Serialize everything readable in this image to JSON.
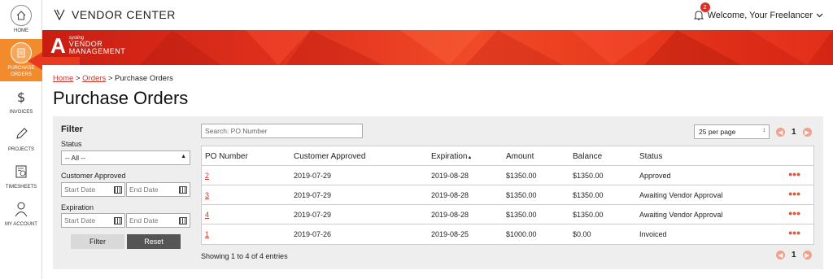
{
  "sidebar": {
    "items": [
      {
        "label": "HOME",
        "icon": "home-icon",
        "active": false
      },
      {
        "label": "PURCHASE ORDERS",
        "icon": "document-icon",
        "active": true
      },
      {
        "label": "INVOICES",
        "icon": "dollar-icon",
        "active": false
      },
      {
        "label": "PROJECTS",
        "icon": "pencil-icon",
        "active": false
      },
      {
        "label": "TIMESHEETS",
        "icon": "timesheet-icon",
        "active": false
      },
      {
        "label": "MY ACCOUNT",
        "icon": "user-icon",
        "active": false
      }
    ]
  },
  "header": {
    "brand": "VENDOR CENTER",
    "notification_count": "2",
    "welcome": "Welcome, Your Freelancer"
  },
  "banner": {
    "logo_letter": "A",
    "logo_small": "sysling",
    "logo_line1": "VENDOR",
    "logo_line2": "MANAGEMENT"
  },
  "breadcrumb": {
    "home": "Home",
    "sep1": " > ",
    "orders": "Orders",
    "sep2": " > ",
    "current": "Purchase Orders"
  },
  "page_title": "Purchase Orders",
  "filter": {
    "title": "Filter",
    "status_label": "Status",
    "status_value": "-- All --",
    "customer_approved_label": "Customer Approved",
    "expiration_label": "Expiration",
    "start_date_placeholder": "Start Date",
    "end_date_placeholder": "End Date",
    "filter_button": "Filter",
    "reset_button": "Reset"
  },
  "search": {
    "placeholder": "Search: PO Number"
  },
  "per_page": "25 per page",
  "pager": {
    "page": "1"
  },
  "table": {
    "headers": [
      "PO Number",
      "Customer Approved",
      "Expiration",
      "Amount",
      "Balance",
      "Status"
    ],
    "rows": [
      {
        "po": "2",
        "approved": "2019-07-29",
        "expiration": "2019-08-28",
        "amount": "$1350.00",
        "balance": "$1350.00",
        "status": "Approved"
      },
      {
        "po": "3",
        "approved": "2019-07-29",
        "expiration": "2019-08-28",
        "amount": "$1350.00",
        "balance": "$1350.00",
        "status": "Awaiting Vendor Approval"
      },
      {
        "po": "4",
        "approved": "2019-07-29",
        "expiration": "2019-08-28",
        "amount": "$1350.00",
        "balance": "$1350.00",
        "status": "Awaiting Vendor Approval"
      },
      {
        "po": "1",
        "approved": "2019-07-26",
        "expiration": "2019-08-25",
        "amount": "$1000.00",
        "balance": "$0.00",
        "status": "Invoiced"
      }
    ],
    "row_menu": "•••"
  },
  "showing": "Showing 1 to 4 of 4 entries",
  "colors": {
    "accent": "#f28b2b",
    "link": "#c43a2e",
    "banner_red": "#e0301c"
  }
}
